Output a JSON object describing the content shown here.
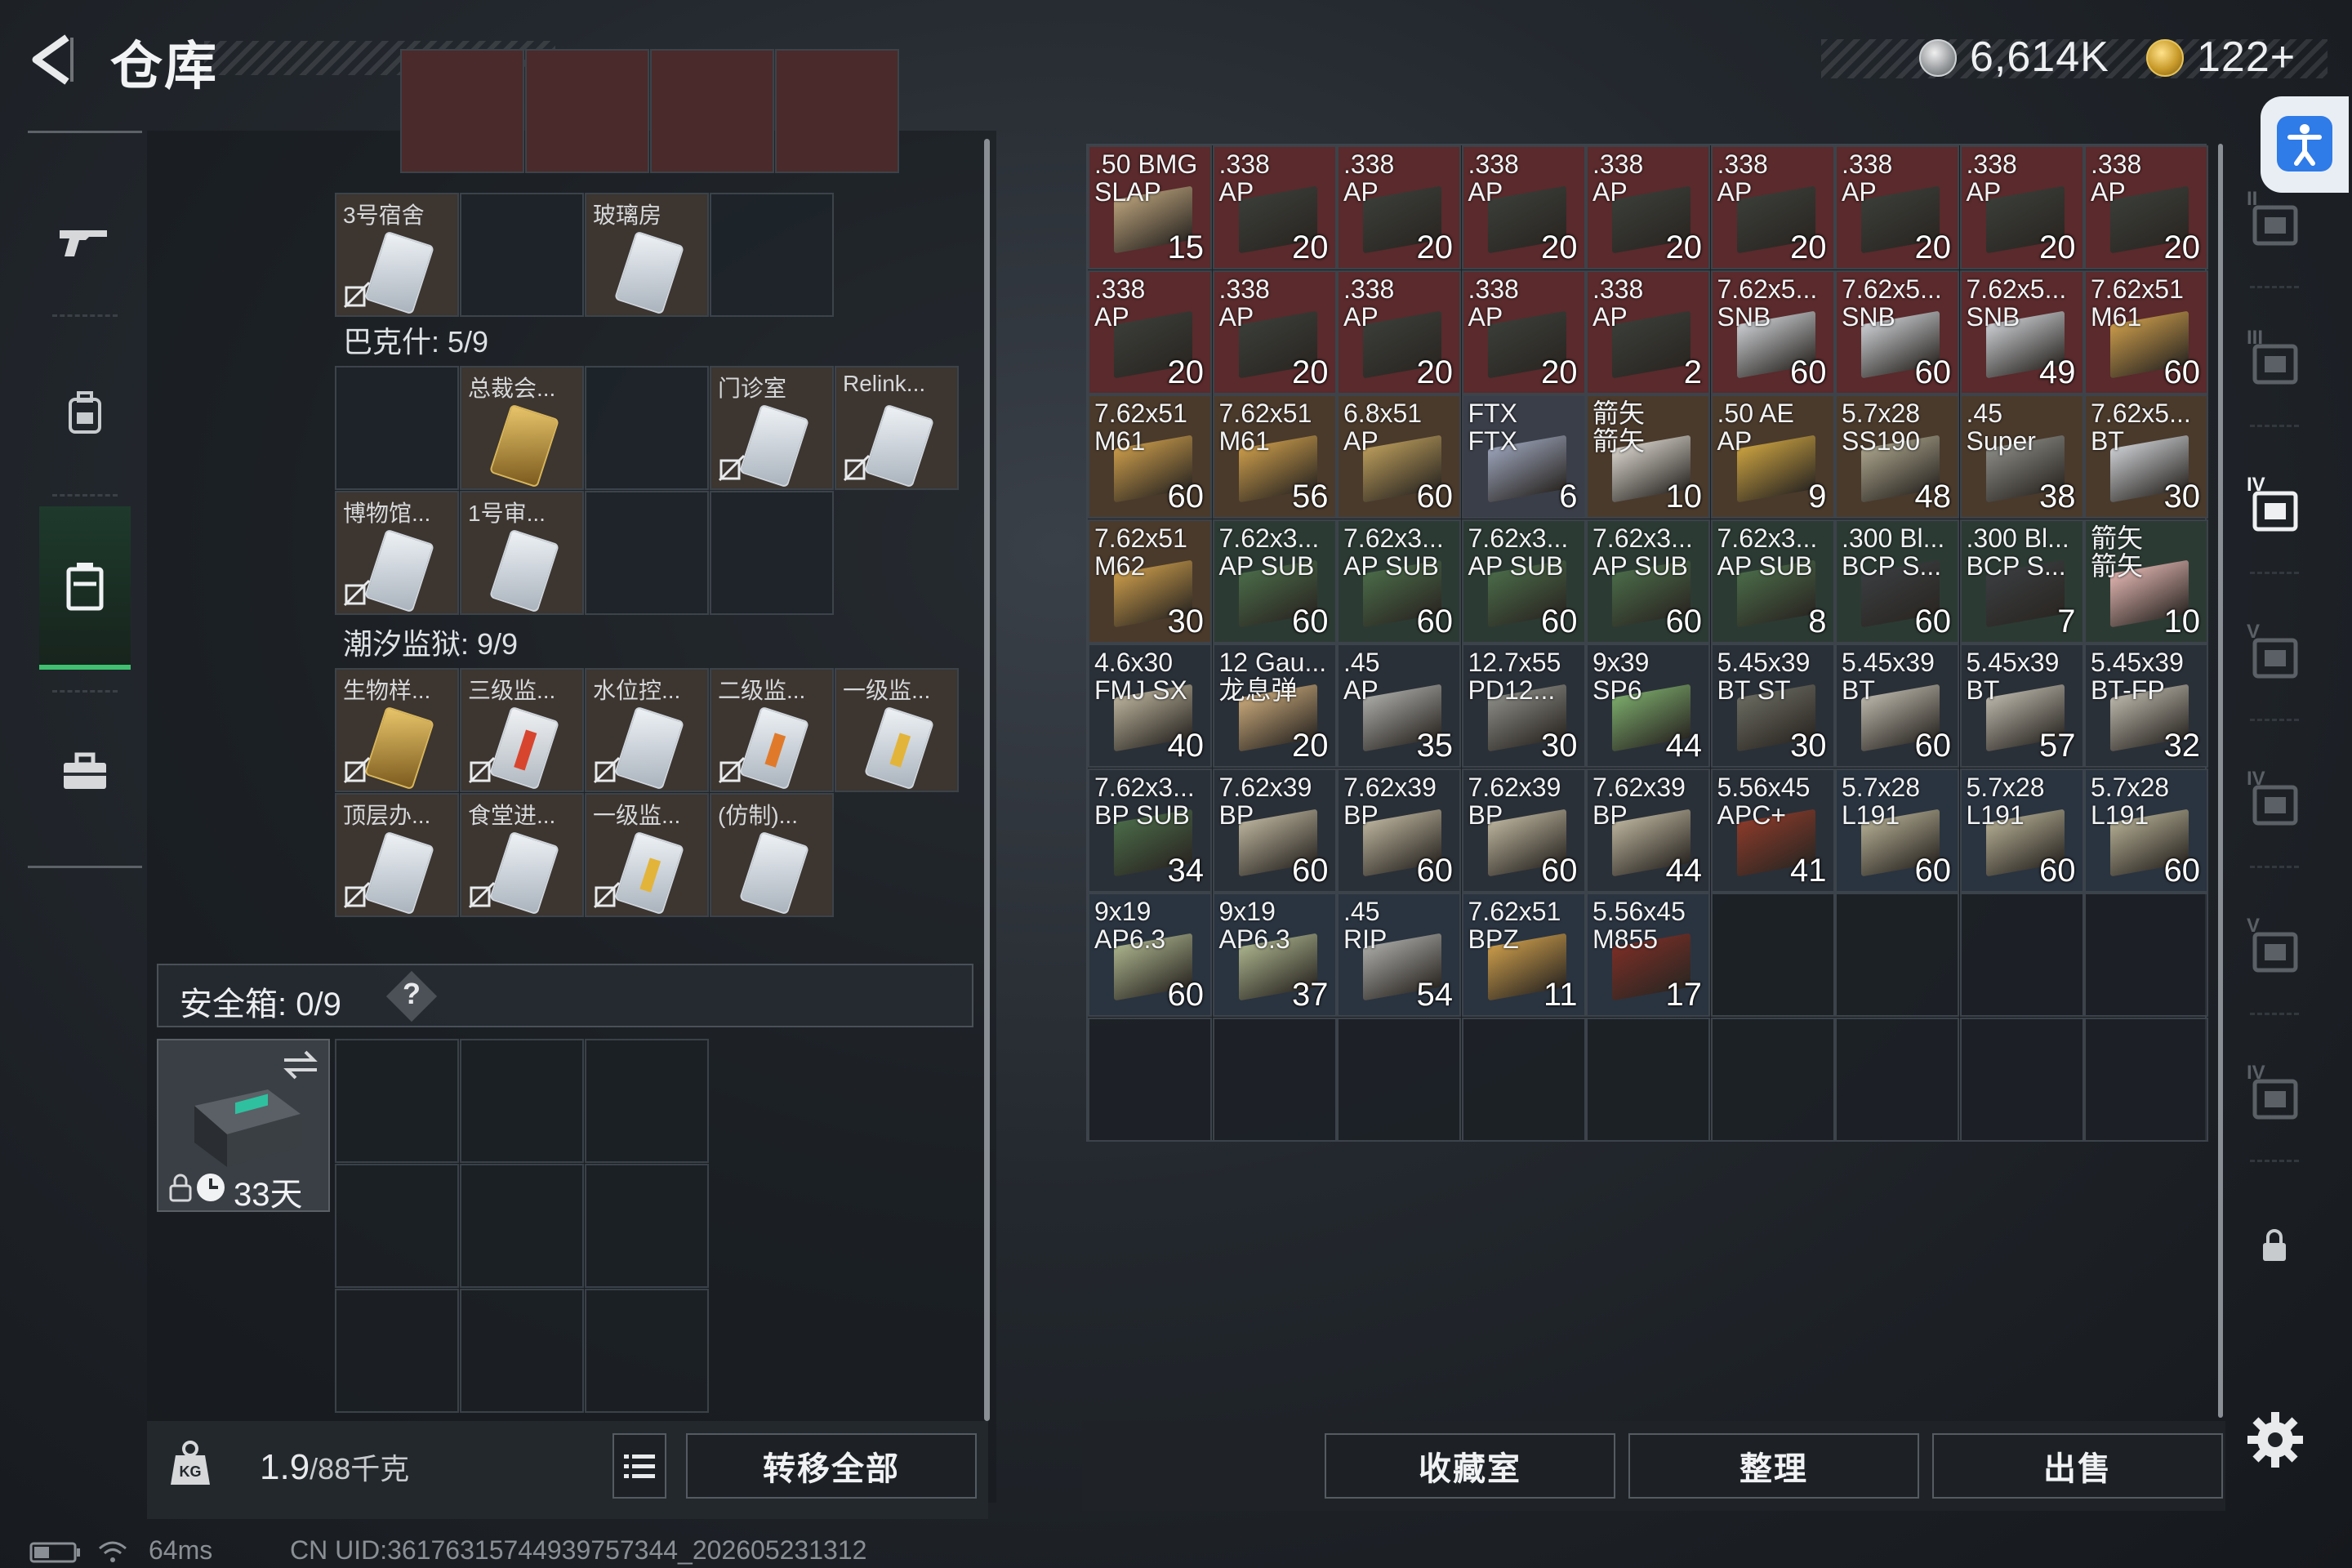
{
  "header": {
    "title": "仓库",
    "currency_silver": "6,614K",
    "currency_gold": "122+"
  },
  "containers": {
    "sections": [
      {
        "label": "巴克什: 5/9"
      },
      {
        "label": "潮汐监狱: 9/9"
      }
    ],
    "row_top": [
      {
        "label": "3号宿舍",
        "style": "white",
        "nodrop": true
      },
      {
        "label": "",
        "style": "empty"
      },
      {
        "label": "玻璃房",
        "style": "white",
        "nodrop": false
      },
      {
        "label": "",
        "style": "empty"
      }
    ],
    "bakeshi": [
      {
        "label": "",
        "style": "empty"
      },
      {
        "label": "总裁会...",
        "style": "gold",
        "nodrop": false
      },
      {
        "label": "",
        "style": "empty"
      },
      {
        "label": "门诊室",
        "style": "white",
        "nodrop": true
      },
      {
        "label": "Relink...",
        "style": "white",
        "nodrop": true
      },
      {
        "label": "博物馆...",
        "style": "white",
        "nodrop": true
      },
      {
        "label": "1号审...",
        "style": "white",
        "nodrop": false
      },
      {
        "label": "",
        "style": "empty"
      },
      {
        "label": "",
        "style": "empty"
      }
    ],
    "chaoxi": [
      {
        "label": "生物样...",
        "style": "gold",
        "nodrop": true
      },
      {
        "label": "三级监...",
        "style": "red",
        "nodrop": true
      },
      {
        "label": "水位控...",
        "style": "white",
        "nodrop": true
      },
      {
        "label": "二级监...",
        "style": "orange",
        "nodrop": true
      },
      {
        "label": "一级监...",
        "style": "yellow",
        "nodrop": false
      },
      {
        "label": "顶层办...",
        "style": "white",
        "nodrop": true
      },
      {
        "label": "食堂进...",
        "style": "white",
        "nodrop": true
      },
      {
        "label": "一级监...",
        "style": "yellow",
        "nodrop": true
      },
      {
        "label": "(仿制)...",
        "style": "white",
        "nodrop": false
      }
    ],
    "safebox_label": "安全箱: 0/9",
    "safebox_help": "?",
    "safebox_timer": "33天",
    "weight_value": "1.9",
    "weight_max": "/88",
    "weight_unit": "千克",
    "transfer_all": "转移全部"
  },
  "stash": {
    "items": [
      {
        "top": ".50 BMG",
        "sub": "SLAP",
        "count": "15",
        "tone": "#5a2a2c",
        "box": "#b8a07a"
      },
      {
        "top": ".338",
        "sub": "AP",
        "count": "20",
        "tone": "#5a2a2c",
        "box": "#3a3d38"
      },
      {
        "top": ".338",
        "sub": "AP",
        "count": "20",
        "tone": "#5a2a2c",
        "box": "#3a3d38"
      },
      {
        "top": ".338",
        "sub": "AP",
        "count": "20",
        "tone": "#5a2a2c",
        "box": "#3a3d38"
      },
      {
        "top": ".338",
        "sub": "AP",
        "count": "20",
        "tone": "#5a2a2c",
        "box": "#3a3d38"
      },
      {
        "top": ".338",
        "sub": "AP",
        "count": "20",
        "tone": "#5a2a2c",
        "box": "#3a3d38"
      },
      {
        "top": ".338",
        "sub": "AP",
        "count": "20",
        "tone": "#5a2a2c",
        "box": "#3a3d38"
      },
      {
        "top": ".338",
        "sub": "AP",
        "count": "20",
        "tone": "#5a2a2c",
        "box": "#3a3d38"
      },
      {
        "top": ".338",
        "sub": "AP",
        "count": "20",
        "tone": "#5a2a2c",
        "box": "#3a3d38"
      },
      {
        "top": ".338",
        "sub": "AP",
        "count": "20",
        "tone": "#5a2a2c",
        "box": "#3a3d38"
      },
      {
        "top": ".338",
        "sub": "AP",
        "count": "20",
        "tone": "#5a2a2c",
        "box": "#3a3d38"
      },
      {
        "top": ".338",
        "sub": "AP",
        "count": "20",
        "tone": "#5a2a2c",
        "box": "#3a3d38"
      },
      {
        "top": ".338",
        "sub": "AP",
        "count": "20",
        "tone": "#5a2a2c",
        "box": "#3a3d38"
      },
      {
        "top": ".338",
        "sub": "AP",
        "count": "2",
        "tone": "#5a2a2c",
        "box": "#3a3d38"
      },
      {
        "top": "7.62x5...",
        "sub": "SNB",
        "count": "60",
        "tone": "#5a2a2c",
        "box": "#c9ccd0"
      },
      {
        "top": "7.62x5...",
        "sub": "SNB",
        "count": "60",
        "tone": "#5a2a2c",
        "box": "#c9ccd0"
      },
      {
        "top": "7.62x5...",
        "sub": "SNB",
        "count": "49",
        "tone": "#5a2a2c",
        "box": "#c9ccd0"
      },
      {
        "top": "7.62x51",
        "sub": "M61",
        "count": "60",
        "tone": "#5a2a2c",
        "box": "#c89a4a"
      },
      {
        "top": "7.62x51",
        "sub": "M61",
        "count": "60",
        "tone": "#4a3a2c",
        "box": "#c89a4a"
      },
      {
        "top": "7.62x51",
        "sub": "M61",
        "count": "56",
        "tone": "#4a3a2c",
        "box": "#c89a4a"
      },
      {
        "top": "6.8x51",
        "sub": "AP",
        "count": "60",
        "tone": "#4a3a2c",
        "box": "#b89a5a"
      },
      {
        "top": "FTX",
        "sub": "FTX",
        "count": "6",
        "tone": "#3a3e48",
        "box": "#9aa2b8"
      },
      {
        "top": "箭矢",
        "sub": "箭矢",
        "count": "10",
        "tone": "#4a3a2c",
        "box": "#d8d4cc"
      },
      {
        "top": ".50 AE",
        "sub": "AP",
        "count": "9",
        "tone": "#4a3a2c",
        "box": "#c8a040"
      },
      {
        "top": "5.7x28",
        "sub": "SS190",
        "count": "48",
        "tone": "#4a3a2c",
        "box": "#a8a28a"
      },
      {
        "top": ".45",
        "sub": "Super",
        "count": "38",
        "tone": "#4a3a2c",
        "box": "#8a8a84"
      },
      {
        "top": "7.62x5...",
        "sub": "BT",
        "count": "30",
        "tone": "#4a3a2c",
        "box": "#c9ccd0"
      },
      {
        "top": "7.62x51",
        "sub": "M62",
        "count": "30",
        "tone": "#4a3a2c",
        "box": "#c89a4a"
      },
      {
        "top": "7.62x3...",
        "sub": "AP SUB",
        "count": "60",
        "tone": "#2c3a34",
        "box": "#4a6a48"
      },
      {
        "top": "7.62x3...",
        "sub": "AP SUB",
        "count": "60",
        "tone": "#2c3a34",
        "box": "#4a6a48"
      },
      {
        "top": "7.62x3...",
        "sub": "AP SUB",
        "count": "60",
        "tone": "#2c3a34",
        "box": "#4a6a48"
      },
      {
        "top": "7.62x3...",
        "sub": "AP SUB",
        "count": "60",
        "tone": "#2c3a34",
        "box": "#4a6a48"
      },
      {
        "top": "7.62x3...",
        "sub": "AP SUB",
        "count": "8",
        "tone": "#2c3a34",
        "box": "#4a6a48"
      },
      {
        "top": ".300 Bl...",
        "sub": "BCP S...",
        "count": "60",
        "tone": "#2c3a34",
        "box": "#3a3d40"
      },
      {
        "top": ".300 Bl...",
        "sub": "BCP S...",
        "count": "7",
        "tone": "#2c3a34",
        "box": "#3a3d40"
      },
      {
        "top": "箭矢",
        "sub": "箭矢",
        "count": "10",
        "tone": "#2c3a34",
        "box": "#e0b4b0"
      },
      {
        "top": "4.6x30",
        "sub": "FMJ SX",
        "count": "40",
        "tone": "#2a3038",
        "box": "#b8b09a"
      },
      {
        "top": "12 Gau...",
        "sub": "龙息弹",
        "count": "20",
        "tone": "#2a3038",
        "box": "#c8a87a"
      },
      {
        "top": ".45",
        "sub": "AP",
        "count": "35",
        "tone": "#2a3038",
        "box": "#a8a8a4"
      },
      {
        "top": "12.7x55",
        "sub": "PD12...",
        "count": "30",
        "tone": "#2a3038",
        "box": "#8a8a84"
      },
      {
        "top": "9x39",
        "sub": "SP6",
        "count": "44",
        "tone": "#2a3038",
        "box": "#7aa86a"
      },
      {
        "top": "5.45x39",
        "sub": "BT ST",
        "count": "30",
        "tone": "#2a3038",
        "box": "#6a6a60"
      },
      {
        "top": "5.45x39",
        "sub": "BT",
        "count": "60",
        "tone": "#2a3038",
        "box": "#b8b4a8"
      },
      {
        "top": "5.45x39",
        "sub": "BT",
        "count": "57",
        "tone": "#2a3038",
        "box": "#b8b4a8"
      },
      {
        "top": "5.45x39",
        "sub": "BT-FP",
        "count": "32",
        "tone": "#2a3038",
        "box": "#b8b4a8"
      },
      {
        "top": "7.62x3...",
        "sub": "BP SUB",
        "count": "34",
        "tone": "#2a3038",
        "box": "#4a6a48"
      },
      {
        "top": "7.62x39",
        "sub": "BP",
        "count": "60",
        "tone": "#2a3038",
        "box": "#b8b09a"
      },
      {
        "top": "7.62x39",
        "sub": "BP",
        "count": "60",
        "tone": "#2a3038",
        "box": "#b8b09a"
      },
      {
        "top": "7.62x39",
        "sub": "BP",
        "count": "60",
        "tone": "#2a3038",
        "box": "#b8b09a"
      },
      {
        "top": "7.62x39",
        "sub": "BP",
        "count": "44",
        "tone": "#2a3038",
        "box": "#b8b09a"
      },
      {
        "top": "5.56x45",
        "sub": "APC+",
        "count": "41",
        "tone": "#2a3038",
        "box": "#8a3a2a"
      },
      {
        "top": "5.7x28",
        "sub": "L191",
        "count": "60",
        "tone": "#2a3440",
        "box": "#b0aa90"
      },
      {
        "top": "5.7x28",
        "sub": "L191",
        "count": "60",
        "tone": "#2a3440",
        "box": "#b0aa90"
      },
      {
        "top": "5.7x28",
        "sub": "L191",
        "count": "60",
        "tone": "#2a3440",
        "box": "#b0aa90"
      },
      {
        "top": "9x19",
        "sub": "AP6.3",
        "count": "60",
        "tone": "#2a3440",
        "box": "#a8b08a"
      },
      {
        "top": "9x19",
        "sub": "AP6.3",
        "count": "37",
        "tone": "#2a3440",
        "box": "#a8b08a"
      },
      {
        "top": ".45",
        "sub": "RIP",
        "count": "54",
        "tone": "#2a3440",
        "box": "#a8a8a4"
      },
      {
        "top": "7.62x51",
        "sub": "BPZ",
        "count": "11",
        "tone": "#2a3440",
        "box": "#c89a4a"
      },
      {
        "top": "5.56x45",
        "sub": "M855",
        "count": "17",
        "tone": "#2a3440",
        "box": "#7a2e26"
      }
    ],
    "btn_collection": "收藏室",
    "btn_sort": "整理",
    "btn_sell": "出售"
  },
  "right_nav": {
    "tabs": [
      "II",
      "III",
      "IV",
      "V",
      "IV",
      "V",
      "IV"
    ]
  },
  "status": {
    "ping": "64ms",
    "uid": "CN UID:36176315744939757344_202605231312"
  }
}
